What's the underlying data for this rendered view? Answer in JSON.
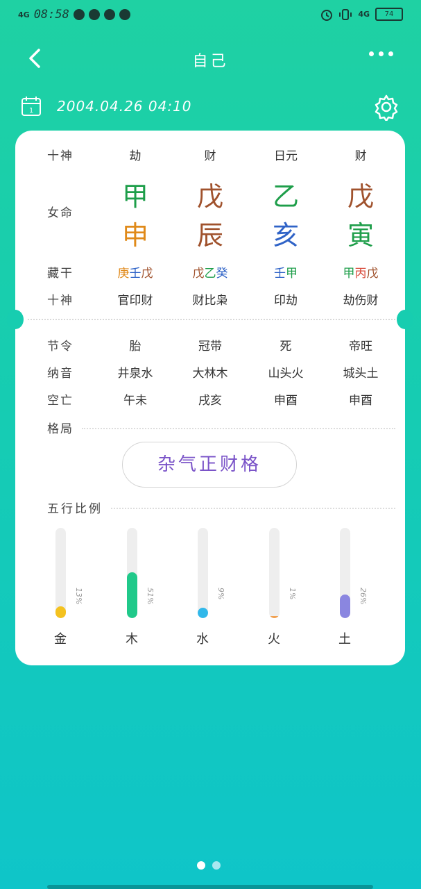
{
  "status_bar": {
    "network_left": "4G",
    "time": "08:58",
    "network_right": "4G",
    "battery": "74"
  },
  "header": {
    "title": "自己",
    "back_icon": "chevron-left-icon",
    "more_icon": "more-dots-icon"
  },
  "date_bar": {
    "calendar_icon": "calendar-icon",
    "calendar_day": "1",
    "date": "2004.04.26 04:10",
    "settings_icon": "gear-icon"
  },
  "chart": {
    "row_labels": {
      "shishen_top": "十神",
      "gender": "女命",
      "canggan": "藏干",
      "shishen_bottom": "十神",
      "jieling": "节令",
      "nayin": "纳音",
      "kongwang": "空亡",
      "geju": "格局"
    },
    "pillars": [
      {
        "shishen": "劫",
        "stem": "甲",
        "stem_color": "#1e9e4a",
        "branch": "申",
        "branch_color": "#e08a1a",
        "canggan": [
          {
            "t": "庚",
            "c": "#e08a1a"
          },
          {
            "t": "壬",
            "c": "#2f63c7"
          },
          {
            "t": "戊",
            "c": "#a0522d"
          }
        ],
        "shishen_hidden": "官印财",
        "jieling": "胎",
        "nayin": "井泉水",
        "kongwang": "午未"
      },
      {
        "shishen": "财",
        "stem": "戊",
        "stem_color": "#a0522d",
        "branch": "辰",
        "branch_color": "#a0522d",
        "canggan": [
          {
            "t": "戊",
            "c": "#a0522d"
          },
          {
            "t": "乙",
            "c": "#1e9e4a"
          },
          {
            "t": "癸",
            "c": "#2f63c7"
          }
        ],
        "shishen_hidden": "财比枭",
        "jieling": "冠带",
        "nayin": "大林木",
        "kongwang": "戌亥"
      },
      {
        "shishen": "日元",
        "stem": "乙",
        "stem_color": "#1e9e4a",
        "branch": "亥",
        "branch_color": "#2f63c7",
        "canggan": [
          {
            "t": "壬",
            "c": "#2f63c7"
          },
          {
            "t": "甲",
            "c": "#1e9e4a"
          }
        ],
        "shishen_hidden": "印劫",
        "jieling": "死",
        "nayin": "山头火",
        "kongwang": "申酉"
      },
      {
        "shishen": "财",
        "stem": "戊",
        "stem_color": "#a0522d",
        "branch": "寅",
        "branch_color": "#1e9e4a",
        "canggan": [
          {
            "t": "甲",
            "c": "#1e9e4a"
          },
          {
            "t": "丙",
            "c": "#d94a3a"
          },
          {
            "t": "戊",
            "c": "#a0522d"
          }
        ],
        "shishen_hidden": "劫伤财",
        "jieling": "帝旺",
        "nayin": "城头土",
        "kongwang": "申酉"
      }
    ],
    "geju_value": "杂气正财格"
  },
  "wuxing": {
    "title": "五行比例",
    "elements": [
      {
        "name": "金",
        "percent_label": "13%",
        "value": 0.13,
        "color": "#f4c21f"
      },
      {
        "name": "木",
        "percent_label": "51%",
        "value": 0.51,
        "color": "#20c98a"
      },
      {
        "name": "水",
        "percent_label": "9%",
        "value": 0.09,
        "color": "#31b8ea"
      },
      {
        "name": "火",
        "percent_label": "1%",
        "value": 0.01,
        "color": "#f0a050"
      },
      {
        "name": "土",
        "percent_label": "26%",
        "value": 0.26,
        "color": "#8a86e0"
      }
    ]
  },
  "pager": {
    "active_color": "#ffffff",
    "inactive_color": "#a8e8f0"
  }
}
